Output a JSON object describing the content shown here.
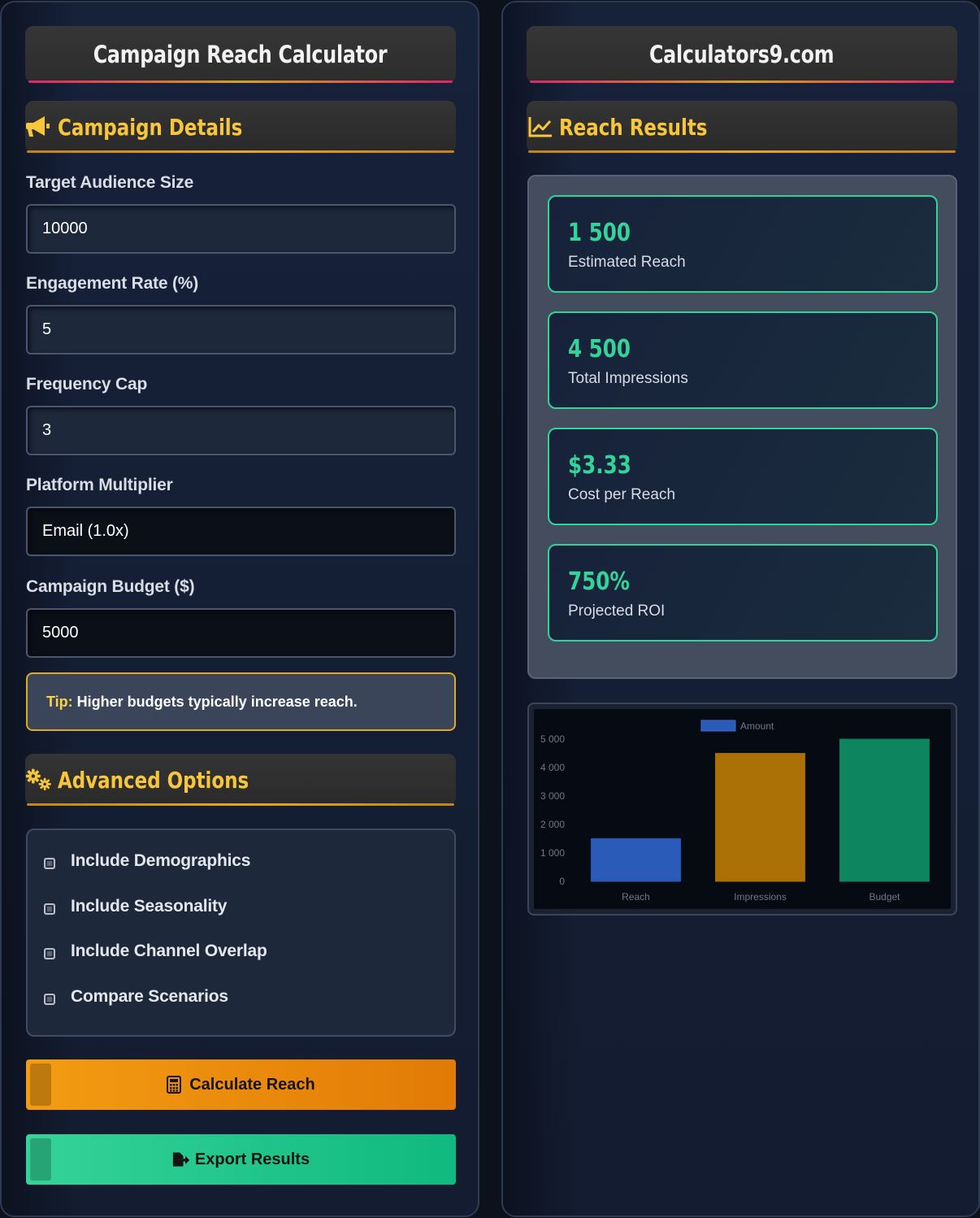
{
  "left": {
    "title": "Campaign Reach Calculator",
    "campaign_details": {
      "heading": "Campaign Details",
      "icon": "megaphone-icon",
      "fields": [
        {
          "label": "Target Audience Size",
          "value": "10000"
        },
        {
          "label": "Engagement Rate (%)",
          "value": "5"
        },
        {
          "label": "Frequency Cap",
          "value": "3"
        },
        {
          "label": "Platform Multiplier",
          "value": "Email (1.0x)"
        },
        {
          "label": "Campaign Budget ($)",
          "value": "5000"
        }
      ]
    },
    "tip": {
      "label": "Tip:",
      "text": "Higher budgets typically increase reach."
    },
    "advanced": {
      "heading": "Advanced Options",
      "icon": "gears-icon",
      "options": [
        {
          "label": "Include Demographics",
          "checked": false
        },
        {
          "label": "Include Seasonality",
          "checked": false
        },
        {
          "label": "Include Channel Overlap",
          "checked": false
        },
        {
          "label": "Compare Scenarios",
          "checked": false
        }
      ]
    },
    "buttons": {
      "calculate": "Calculate Reach",
      "export": "Export Results"
    }
  },
  "right": {
    "title": "Calculators9.com",
    "results": {
      "heading": "Reach Results",
      "icon": "chart-line-icon",
      "cards": [
        {
          "value": "1 500",
          "label": "Estimated Reach"
        },
        {
          "value": "4 500",
          "label": "Total Impressions"
        },
        {
          "value": "$3.33",
          "label": "Cost per Reach"
        },
        {
          "value": "750%",
          "label": "Projected ROI"
        }
      ]
    }
  },
  "colors": {
    "accent_gold": "#f8c63a",
    "accent_green": "#34d399",
    "bar_reach": "#2a5bb8",
    "bar_impressions": "#ac7106",
    "bar_budget": "#0d8660"
  },
  "chart_data": {
    "type": "bar",
    "categories": [
      "Reach",
      "Impressions",
      "Budget"
    ],
    "series": [
      {
        "name": "Amount",
        "values": [
          1500,
          4500,
          5000
        ]
      }
    ],
    "yticks": [
      "0",
      "1 000",
      "2 000",
      "3 000",
      "4 000",
      "5 000"
    ],
    "ylim": [
      0,
      5000
    ],
    "legend": "top",
    "grid": false
  }
}
